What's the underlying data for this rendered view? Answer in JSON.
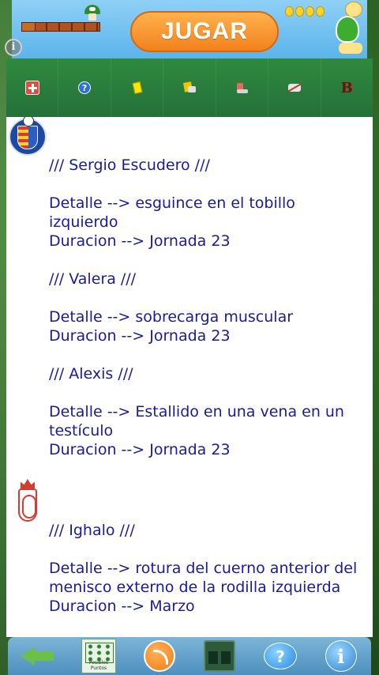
{
  "ad": {
    "button_label": "JUGAR"
  },
  "toolbar": {
    "items": [
      {
        "icon": "injury-cross-icon"
      },
      {
        "icon": "doubt-question-icon"
      },
      {
        "icon": "yellow-card-icon"
      },
      {
        "icon": "card-swap-icon"
      },
      {
        "icon": "boot-icon"
      },
      {
        "icon": "suspension-icon"
      },
      {
        "icon": "b-icon"
      }
    ]
  },
  "teams": [
    {
      "crest": "getafe-crest",
      "lines": [
        "/// Sergio Escudero ///",
        "",
        "Detalle --> esguince en el tobillo izquierdo",
        "Duracion --> Jornada 23",
        "",
        "/// Valera ///",
        "",
        "Detalle --> sobrecarga muscular",
        "Duracion --> Jornada 23",
        "",
        "/// Alexis ///",
        "",
        "Detalle --> Estallido en una vena en un testículo",
        "Duracion --> Jornada 23"
      ]
    },
    {
      "crest": "granada-crest",
      "lines": [
        "/// Ighalo ///",
        "",
        "Detalle --> rotura del cuerno anterior del menisco externo de la rodilla izquierda",
        "Duracion --> Marzo"
      ]
    }
  ],
  "bottombar": {
    "lineup_caption": "Posibles Puntos",
    "help_symbol": "?",
    "info_symbol": "i",
    "items": [
      {
        "icon": "back-arrow-icon"
      },
      {
        "icon": "lineup-icon"
      },
      {
        "icon": "rss-icon"
      },
      {
        "icon": "scoreboard-icon"
      },
      {
        "icon": "help-icon"
      },
      {
        "icon": "info-icon"
      }
    ]
  },
  "colors": {
    "text": "#1a1a9c",
    "toolbar": "#2e8a3e",
    "ad_button": "#f2821c"
  }
}
